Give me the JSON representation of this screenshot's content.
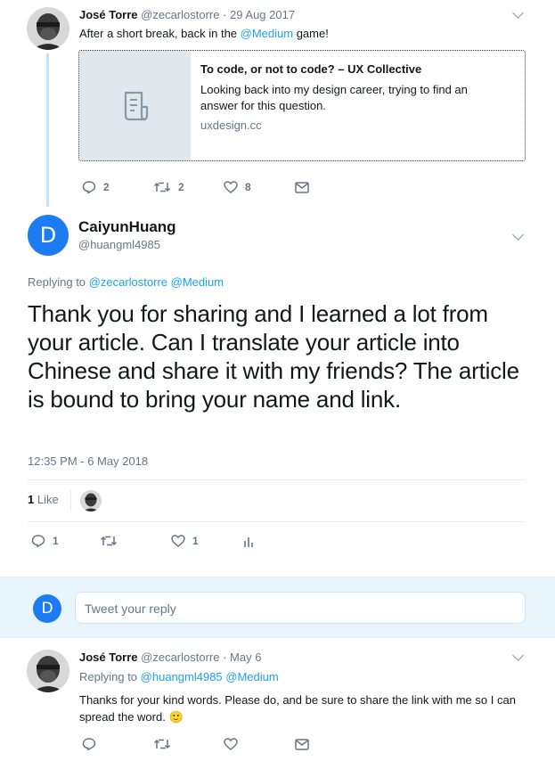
{
  "tweet1": {
    "author_name": "José Torre",
    "author_handle": "@zecarlostorre",
    "date": "· 29 Aug 2017",
    "text_prefix": "After a short break, back in the ",
    "text_mention": "@Medium",
    "text_suffix": " game!",
    "card": {
      "title": "To code, or not to code? – UX Collective",
      "description": "Looking back into my design career, trying to find an answer for this question.",
      "domain": "uxdesign.cc"
    },
    "actions": {
      "replies": "2",
      "retweets": "2",
      "likes": "8"
    }
  },
  "tweet2": {
    "avatar_letter": "D",
    "author_name": "CaiyunHuang",
    "author_handle": "@huangml4985",
    "replying_label": "Replying to",
    "replying_mentions": "@zecarlostorre @Medium",
    "text": "Thank you for sharing and I learned a lot from your article. Can I translate your article into Chinese and share it with my friends? The article is bound to bring your name and link.",
    "timestamp": "12:35 PM - 6 May 2018",
    "likes_count": "1",
    "likes_label": "Like",
    "actions": {
      "replies": "1",
      "retweets": "",
      "likes": "1"
    }
  },
  "reply_box": {
    "avatar_letter": "D",
    "placeholder": "Tweet your reply"
  },
  "tweet3": {
    "author_name": "José Torre",
    "author_handle": "@zecarlostorre",
    "date": "· May 6",
    "replying_label": "Replying to",
    "replying_mentions": "@huangml4985 @Medium",
    "text": "Thanks for your kind words. Please do, and be sure to share the link with me so I can spread the word. 🙂"
  },
  "colors": {
    "accent": "#1da1f2",
    "avatar_blue": "#1d7cf2",
    "muted": "#657786",
    "border": "#e6ecf0",
    "thread_line": "#c4e4fa"
  }
}
